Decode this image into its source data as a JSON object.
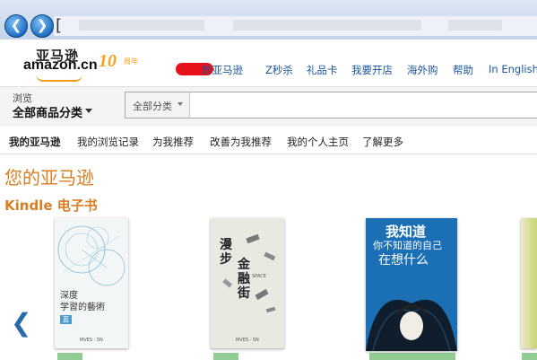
{
  "browser": {
    "back_icon": "back-arrow-icon",
    "forward_icon": "forward-arrow-icon",
    "address_start": "["
  },
  "header": {
    "logo_cn": "亚马逊",
    "logo_en": "amazon.cn",
    "anniversary": "10",
    "anniversary_suffix": "周年",
    "top_links": [
      "的亚马逊",
      "Z秒杀",
      "礼品卡",
      "我要开店",
      "海外购",
      "帮助",
      "In English"
    ]
  },
  "search": {
    "browse_label": "浏览",
    "all_categories": "全部商品分类",
    "dropdown_label": "全部分类"
  },
  "subnav": {
    "items": [
      "我的亚马逊",
      "我的浏览记录",
      "为我推荐",
      "改善为我推荐",
      "我的个人主页",
      "了解更多"
    ]
  },
  "main": {
    "page_title": "您的亚马逊",
    "section_title": "Kindle 电子书",
    "prev_arrow": "❮"
  },
  "books": [
    {
      "title": "深度\n学習的藝術",
      "badge": "蓝",
      "footer": "MVES · 5N"
    },
    {
      "title_a": "漫步",
      "title_b": "金融街",
      "sub": "SPACE",
      "footer": "MVES · 5N"
    },
    {
      "title_a": "我知道",
      "title_b": "你不知道的自己",
      "title_c": "在想什么"
    },
    {}
  ]
}
